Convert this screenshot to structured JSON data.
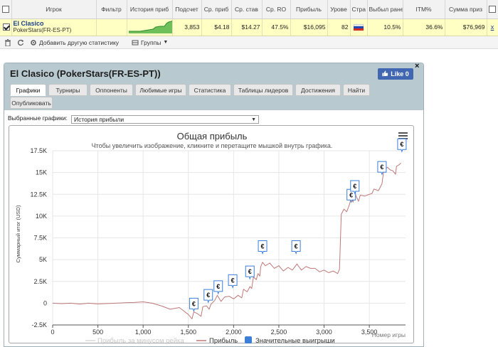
{
  "table": {
    "headers": [
      "Игрок",
      "Фильтр",
      "История приб",
      "Подсчет",
      "Ср. приб",
      "Ср. став",
      "Ср. RO",
      "Прибыль",
      "Урове",
      "Стра",
      "Выбыл ране",
      "ITM%",
      "Сумма приз"
    ],
    "row": {
      "player": "El Clasico",
      "site": "PokerStars(FR-ES-PT)",
      "filter": "",
      "count": "3,853",
      "avg_profit": "$4.18",
      "avg_stake": "$14.27",
      "avg_roi": "47.5%",
      "profit": "$16,095",
      "level": "82",
      "early_out": "10.5%",
      "itm": "36.6%",
      "prize_sum": "$76,969",
      "extra": "х"
    }
  },
  "toolbar": {
    "add_stats": "Добавить другую статистику",
    "groups": "Группы"
  },
  "panel": {
    "title": "El Clasico (PokerStars(FR-ES-PT))",
    "like": "Like 0",
    "close": "×",
    "tabs": [
      "Графики",
      "Турниры",
      "Оппоненты",
      "Любимые игры",
      "Статистика",
      "Таблицы лидеров",
      "Достижения",
      "Найти",
      "Опубликовать"
    ],
    "select_label": "Выбранные графики:",
    "select_value": "История прибыли"
  },
  "chart_data": {
    "type": "line",
    "title": "Общая прибыль",
    "subtitle": "Чтобы увеличить изображение, кликните и перетащите мышкой внутрь графика.",
    "ylabel": "Суммарный итог (USD)",
    "xlabel": "Номер игры",
    "xlim": [
      0,
      3900
    ],
    "ylim": [
      -2500,
      17500
    ],
    "yticks": [
      "17.5K",
      "15K",
      "12.5K",
      "10K",
      "7.5K",
      "5K",
      "2.5K",
      "0",
      "-2.5K"
    ],
    "ytick_values": [
      17500,
      15000,
      12500,
      10000,
      7500,
      5000,
      2500,
      0,
      -2500
    ],
    "xticks": [
      "0",
      "500",
      "1,000",
      "1,500",
      "2,000",
      "2,500",
      "3,000",
      "3,500"
    ],
    "xtick_values": [
      0,
      500,
      1000,
      1500,
      2000,
      2500,
      3000,
      3500
    ],
    "grid": true,
    "legend_position": "bottom",
    "series": [
      {
        "name": "Прибыль",
        "color": "#c07878",
        "points": [
          [
            0,
            0
          ],
          [
            100,
            -50
          ],
          [
            200,
            0
          ],
          [
            300,
            -100
          ],
          [
            400,
            0
          ],
          [
            500,
            -80
          ],
          [
            600,
            -40
          ],
          [
            700,
            0
          ],
          [
            800,
            50
          ],
          [
            900,
            80
          ],
          [
            1000,
            150
          ],
          [
            1100,
            0
          ],
          [
            1200,
            -300
          ],
          [
            1300,
            -700
          ],
          [
            1400,
            -500
          ],
          [
            1450,
            -900
          ],
          [
            1500,
            -1300
          ],
          [
            1540,
            -1800
          ],
          [
            1560,
            -1000
          ],
          [
            1600,
            -1200
          ],
          [
            1640,
            -1500
          ],
          [
            1660,
            -400
          ],
          [
            1700,
            -300
          ],
          [
            1730,
            -700
          ],
          [
            1750,
            -100
          ],
          [
            1790,
            300
          ],
          [
            1820,
            900
          ],
          [
            1860,
            200
          ],
          [
            1900,
            700
          ],
          [
            1950,
            800
          ],
          [
            2000,
            500
          ],
          [
            2050,
            900
          ],
          [
            2090,
            600
          ],
          [
            2110,
            1600
          ],
          [
            2150,
            1300
          ],
          [
            2180,
            1900
          ],
          [
            2200,
            1700
          ],
          [
            2220,
            3000
          ],
          [
            2250,
            2700
          ],
          [
            2270,
            3400
          ],
          [
            2290,
            3100
          ],
          [
            2300,
            4200
          ],
          [
            2320,
            4700
          ],
          [
            2350,
            4300
          ],
          [
            2400,
            4600
          ],
          [
            2450,
            4000
          ],
          [
            2500,
            4300
          ],
          [
            2550,
            3700
          ],
          [
            2600,
            4100
          ],
          [
            2650,
            3800
          ],
          [
            2700,
            4500
          ],
          [
            2750,
            3800
          ],
          [
            2800,
            4200
          ],
          [
            2850,
            4000
          ],
          [
            2900,
            4000
          ],
          [
            2950,
            3600
          ],
          [
            3000,
            3800
          ],
          [
            3050,
            3500
          ],
          [
            3100,
            3700
          ],
          [
            3150,
            3400
          ],
          [
            3170,
            3900
          ],
          [
            3190,
            10200
          ],
          [
            3220,
            10800
          ],
          [
            3250,
            10500
          ],
          [
            3280,
            11300
          ],
          [
            3300,
            12100
          ],
          [
            3320,
            11600
          ],
          [
            3340,
            12600
          ],
          [
            3380,
            11700
          ],
          [
            3400,
            12400
          ],
          [
            3450,
            12300
          ],
          [
            3500,
            12500
          ],
          [
            3530,
            12600
          ],
          [
            3550,
            13100
          ],
          [
            3580,
            13000
          ],
          [
            3600,
            12900
          ],
          [
            3640,
            13700
          ],
          [
            3660,
            15300
          ],
          [
            3700,
            15600
          ],
          [
            3730,
            15300
          ],
          [
            3760,
            15200
          ],
          [
            3790,
            14800
          ],
          [
            3800,
            15700
          ],
          [
            3830,
            15900
          ],
          [
            3850,
            16095
          ]
        ]
      },
      {
        "name": "Прибыль за минусом рейка",
        "color": "#e0e0e0",
        "points": []
      },
      {
        "name": "Значительные выигрыши",
        "color": "#3b7fd9",
        "points": []
      }
    ],
    "big_wins": [
      [
        1560,
        -900
      ],
      [
        1720,
        100
      ],
      [
        1830,
        1100
      ],
      [
        1990,
        1800
      ],
      [
        2180,
        2800
      ],
      [
        2320,
        5700
      ],
      [
        2690,
        5700
      ],
      [
        3300,
        11600
      ],
      [
        3340,
        12600
      ],
      [
        3640,
        14800
      ],
      [
        3860,
        17400
      ]
    ]
  }
}
